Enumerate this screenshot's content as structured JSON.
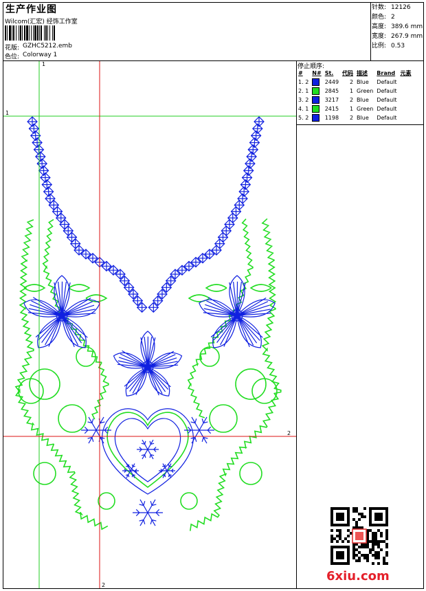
{
  "header": {
    "title": "生产作业图",
    "company": "Wilcom(汇宏) 经饰工作室",
    "design_label": "花版:",
    "design_value": "GZHC5212.emb",
    "colorway_label": "色位:",
    "colorway_value": "Colorway 1"
  },
  "stats": [
    {
      "label": "针数:",
      "value": "12126"
    },
    {
      "label": "颜色:",
      "value": "2"
    },
    {
      "label": "高度:",
      "value": "389.6 mm"
    },
    {
      "label": "宽度:",
      "value": "267.9 mm"
    },
    {
      "label": "比例:",
      "value": "0.53"
    }
  ],
  "stop_sequence": {
    "title": "停止顺序:",
    "columns": [
      "#",
      "N#",
      "St.",
      "代码",
      "描述",
      "Brand",
      "元素"
    ],
    "rows": [
      {
        "idx": "1.",
        "n": "2",
        "color": "#1020e0",
        "stitches": "2449",
        "code": "2",
        "desc": "Blue",
        "brand": "Default",
        "element": ""
      },
      {
        "idx": "2.",
        "n": "1",
        "color": "#22dd22",
        "stitches": "2845",
        "code": "1",
        "desc": "Green",
        "brand": "Default",
        "element": ""
      },
      {
        "idx": "3.",
        "n": "2",
        "color": "#1020e0",
        "stitches": "3217",
        "code": "2",
        "desc": "Blue",
        "brand": "Default",
        "element": ""
      },
      {
        "idx": "4.",
        "n": "1",
        "color": "#22dd22",
        "stitches": "2415",
        "code": "1",
        "desc": "Green",
        "brand": "Default",
        "element": ""
      },
      {
        "idx": "5.",
        "n": "2",
        "color": "#1020e0",
        "stitches": "1198",
        "code": "2",
        "desc": "Blue",
        "brand": "Default",
        "element": ""
      }
    ]
  },
  "guides": {
    "top_label": "1",
    "left_label": "1",
    "right_label": "2",
    "bottom_label": "2"
  },
  "colors": {
    "blue": "#1020e0",
    "green": "#22dd22",
    "guide_green": "#22cc22",
    "guide_red": "#dd1111"
  },
  "watermark": "6xiu.com"
}
